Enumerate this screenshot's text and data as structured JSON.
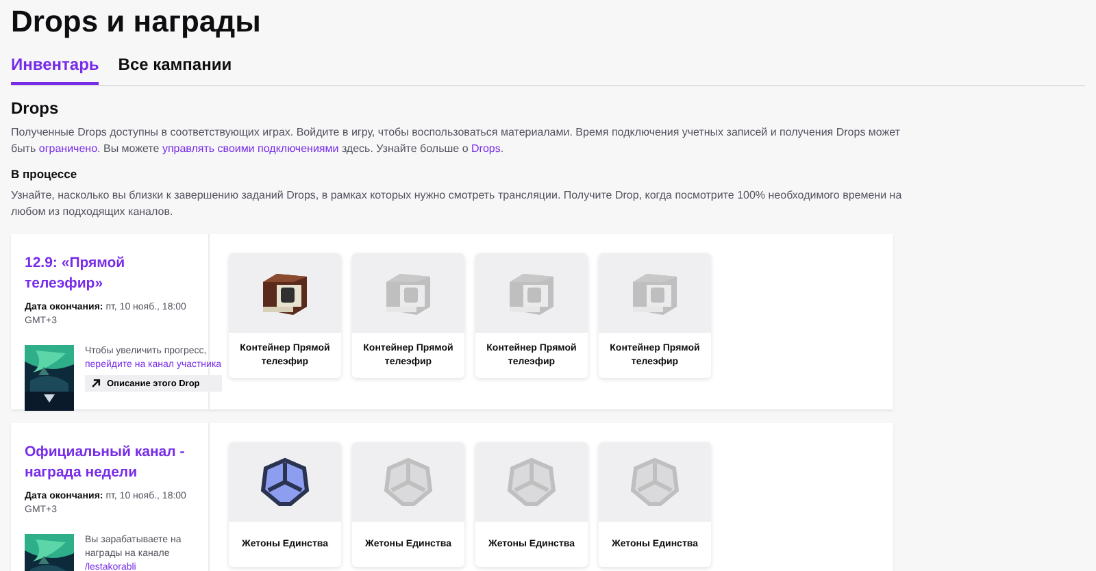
{
  "page_title": "Drops и награды",
  "tabs": [
    {
      "label": "Инвентарь",
      "selected": true
    },
    {
      "label": "Все кампании",
      "selected": false
    }
  ],
  "section": {
    "title": "Drops",
    "text": "Полученные Drops доступны в соответствующих играх. Войдите в игру, чтобы воспользоваться материалами. Время подключения учетных записей и получения Drops может быть ",
    "links": [
      {
        "text": "ограничено",
        "after": ". Вы можете "
      },
      {
        "text": "управлять своими подключениями",
        "after": " здесь. Узнайте больше о "
      },
      {
        "text": "Drops",
        "after": "."
      }
    ]
  },
  "in_progress": {
    "title": "В процессе",
    "text": "Узнайте, насколько вы близки к завершению заданий Drops, в рамках которых нужно смотреть трансляции. Получите Drop, когда посмотрите 100% необходимого времени на любом из подходящих каналов."
  },
  "campaigns": [
    {
      "title": "12.9: «Прямой телеэфир»",
      "end_label": "Дата окончания:",
      "end_date": " пт, 10 нояб., 18:00 GMT+3",
      "info_text": "Чтобы увеличить прогресс, ",
      "info_link": "перейдите на канал участника",
      "button": "Описание этого Drop",
      "kind": "container",
      "rewards": [
        {
          "name": "Контейнер Прямой телеэфир",
          "earned": true
        },
        {
          "name": "Контейнер Прямой телеэфир",
          "earned": false
        },
        {
          "name": "Контейнер Прямой телеэфир",
          "earned": false
        },
        {
          "name": "Контейнер Прямой телеэфир",
          "earned": false
        }
      ]
    },
    {
      "title": "Официальный канал - награда недели",
      "end_label": "Дата окончания:",
      "end_date": " пт, 10 нояб., 18:00 GMT+3",
      "info_text": "Вы зарабатываете на награды на канале ",
      "info_link": "/lestakorabli",
      "kind": "token",
      "rewards": [
        {
          "name": "Жетоны Единства",
          "earned": true
        },
        {
          "name": "Жетоны Единства",
          "earned": false
        },
        {
          "name": "Жетоны Единства",
          "earned": false
        },
        {
          "name": "Жетоны Единства",
          "earned": false
        }
      ]
    }
  ]
}
